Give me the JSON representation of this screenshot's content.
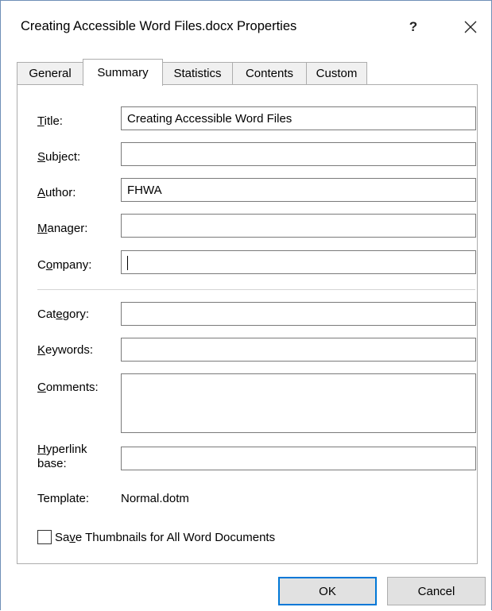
{
  "window": {
    "title": "Creating Accessible Word Files.docx Properties",
    "help_label": "?",
    "accent_color": "#0078d7"
  },
  "tabs": [
    {
      "label": "General",
      "active": false
    },
    {
      "label": "Summary",
      "active": true
    },
    {
      "label": "Statistics",
      "active": false
    },
    {
      "label": "Contents",
      "active": false
    },
    {
      "label": "Custom",
      "active": false
    }
  ],
  "summary": {
    "title": {
      "label_pre": "",
      "label_acc": "T",
      "label_post": "itle:",
      "value": "Creating Accessible Word Files"
    },
    "subject": {
      "label_pre": "",
      "label_acc": "S",
      "label_post": "ubject:",
      "value": ""
    },
    "author": {
      "label_pre": "",
      "label_acc": "A",
      "label_post": "uthor:",
      "value": "FHWA"
    },
    "manager": {
      "label_pre": "",
      "label_acc": "M",
      "label_post": "anager:",
      "value": ""
    },
    "company": {
      "label_pre": "C",
      "label_acc": "o",
      "label_post": "mpany:",
      "value": ""
    },
    "category": {
      "label_pre": "Cat",
      "label_acc": "e",
      "label_post": "gory:",
      "value": ""
    },
    "keywords": {
      "label_pre": "",
      "label_acc": "K",
      "label_post": "eywords:",
      "value": ""
    },
    "comments": {
      "label_pre": "",
      "label_acc": "C",
      "label_post": "omments:",
      "value": ""
    },
    "hyperlink_base": {
      "label_line1_acc": "H",
      "label_line1_post": "yperlink",
      "label_line2": "base:",
      "value": ""
    },
    "template": {
      "label": "Template:",
      "value": "Normal.dotm"
    },
    "save_thumbnails": {
      "label_pre": "Sa",
      "label_acc": "v",
      "label_post": "e Thumbnails for All Word Documents",
      "checked": false
    }
  },
  "buttons": {
    "ok": "OK",
    "cancel": "Cancel"
  }
}
